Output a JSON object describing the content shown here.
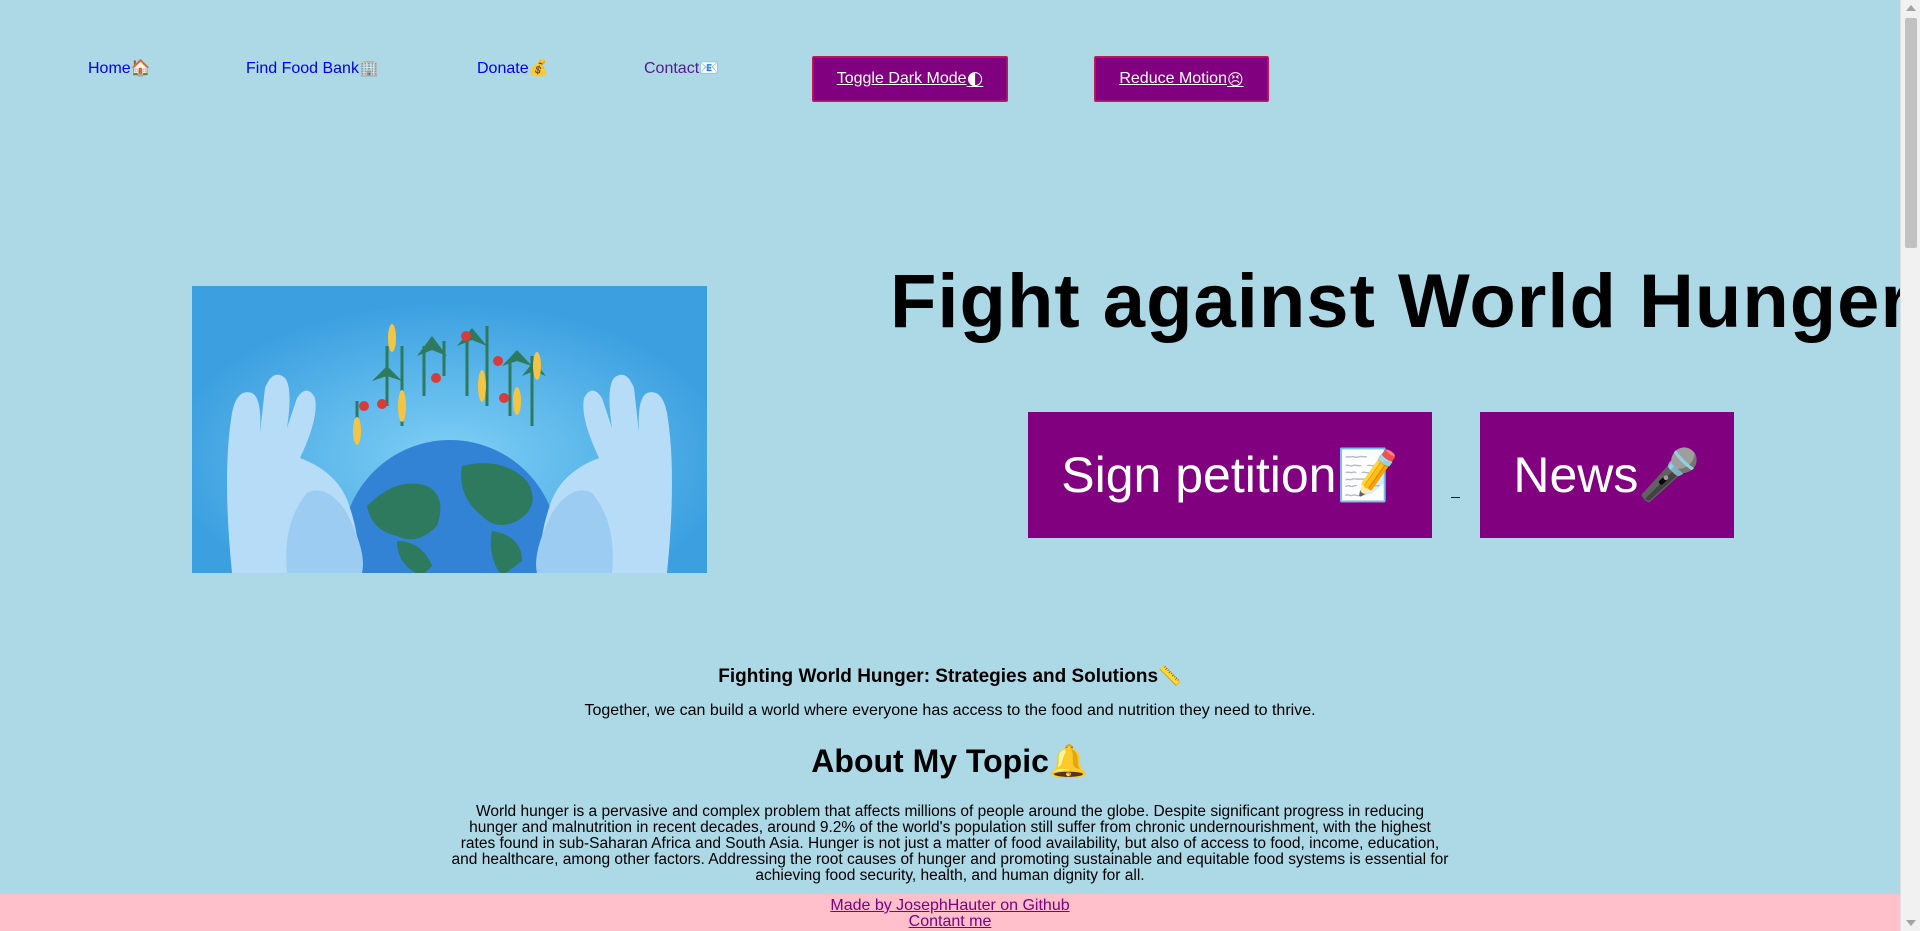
{
  "nav": {
    "links": [
      {
        "label": "Home",
        "icon": "🏠"
      },
      {
        "label": "Find Food Bank",
        "icon": "🏢"
      },
      {
        "label": "Donate",
        "icon": "💰"
      },
      {
        "label": "Contact",
        "icon": "📧"
      }
    ],
    "toggle_dark_mode": {
      "label": "Toggle Dark Mode",
      "icon": "🌓"
    },
    "reduce_motion": {
      "label": "Reduce Motion",
      "icon": "😣"
    }
  },
  "hero": {
    "title": "Fight against World Hunger",
    "sign_petition": {
      "label": "Sign petition",
      "icon": "📝"
    },
    "news": {
      "label": "News",
      "icon": "🎤"
    }
  },
  "content": {
    "subheading": "Fighting World Hunger: Strategies and Solutions",
    "subheading_icon": "📏",
    "tagline": "Together, we can build a world where everyone has access to the food and nutrition they need to thrive.",
    "about_heading": "About My Topic",
    "about_icon": "🔔",
    "about_text": "World hunger is a pervasive and complex problem that affects millions of people around the globe. Despite significant progress in reducing hunger and malnutrition in recent decades, around 9.2% of the world's population still suffer from chronic undernourishment, with the highest rates found in sub-Saharan Africa and South Asia. Hunger is not just a matter of food availability, but also of access to food, income, education, and healthcare, among other factors. Addressing the root causes of hunger and promoting sustainable and equitable food systems is essential for achieving food security, health, and human dignity for all."
  },
  "footer": {
    "github_link": "Made by JosephHauter on Github",
    "contact_link": "Contant me"
  },
  "colors": {
    "background": "#add8e6",
    "accent": "#800080",
    "footer": "#ffc0cb"
  }
}
